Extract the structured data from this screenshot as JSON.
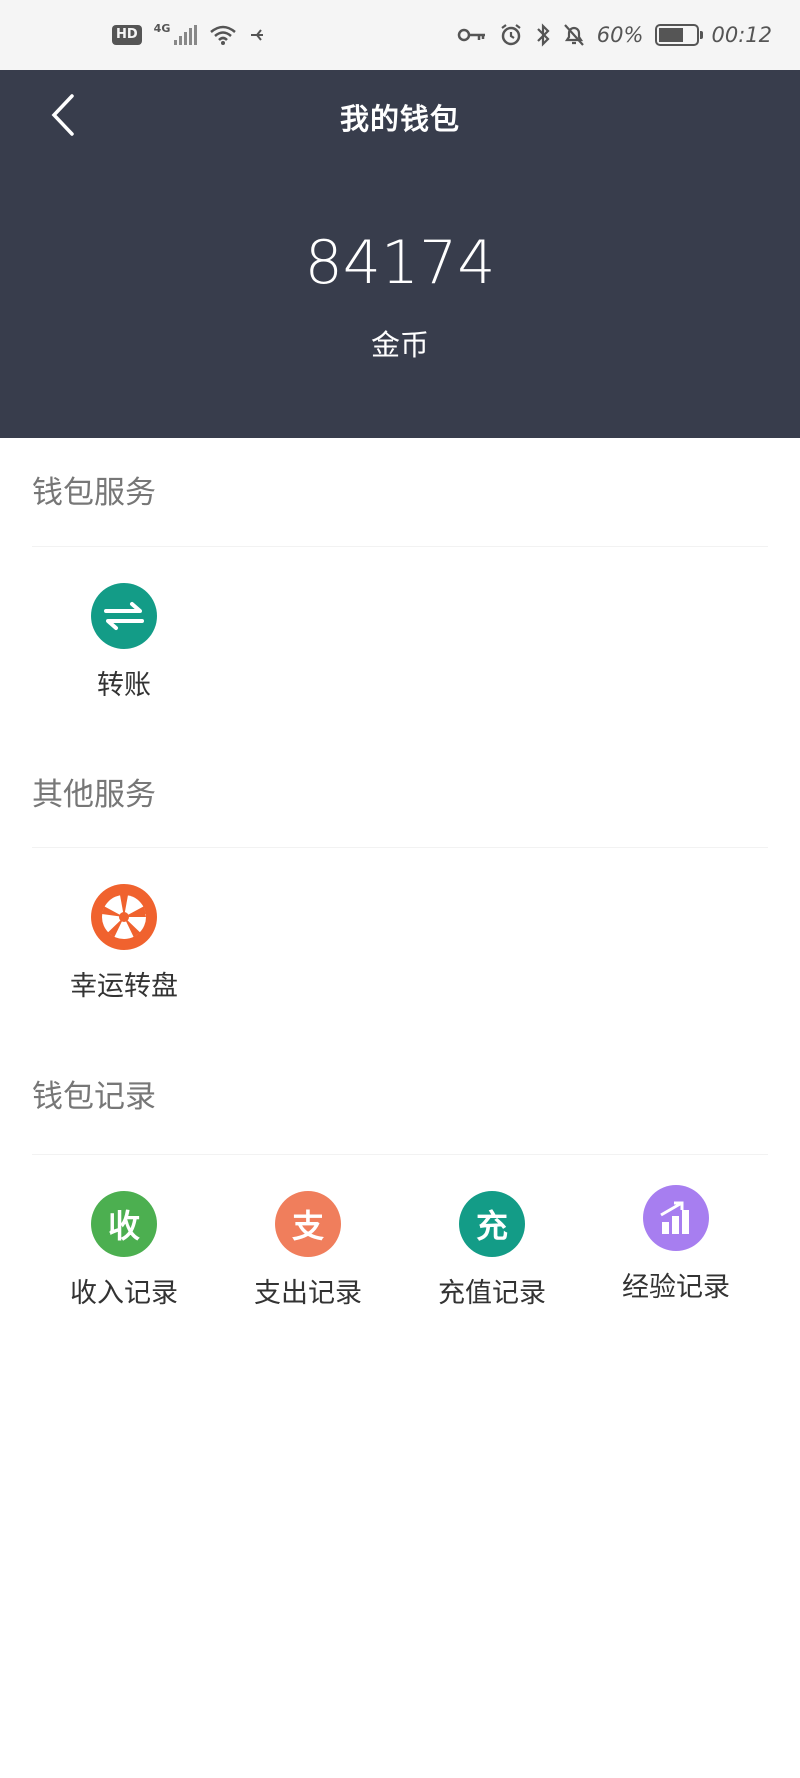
{
  "statusbar": {
    "hd": "HD",
    "network": "4G",
    "battery_percent": "60%",
    "time": "00:12"
  },
  "header": {
    "title": "我的钱包",
    "balance": "84174",
    "unit": "金币"
  },
  "sections": {
    "wallet_services": {
      "title": "钱包服务",
      "items": [
        {
          "label": "转账",
          "icon": "transfer-icon",
          "color": "#139c87"
        }
      ]
    },
    "other_services": {
      "title": "其他服务",
      "items": [
        {
          "label": "幸运转盘",
          "icon": "lucky-wheel-icon",
          "color": "#f0622e"
        }
      ]
    },
    "wallet_records": {
      "title": "钱包记录",
      "items": [
        {
          "label": "收入记录",
          "glyph": "收",
          "color": "#4caf50"
        },
        {
          "label": "支出记录",
          "glyph": "支",
          "color": "#f07e5c"
        },
        {
          "label": "充值记录",
          "glyph": "充",
          "color": "#139c87"
        },
        {
          "label": "经验记录",
          "icon": "bar-chart-icon",
          "color": "#a77ef0"
        }
      ]
    }
  }
}
